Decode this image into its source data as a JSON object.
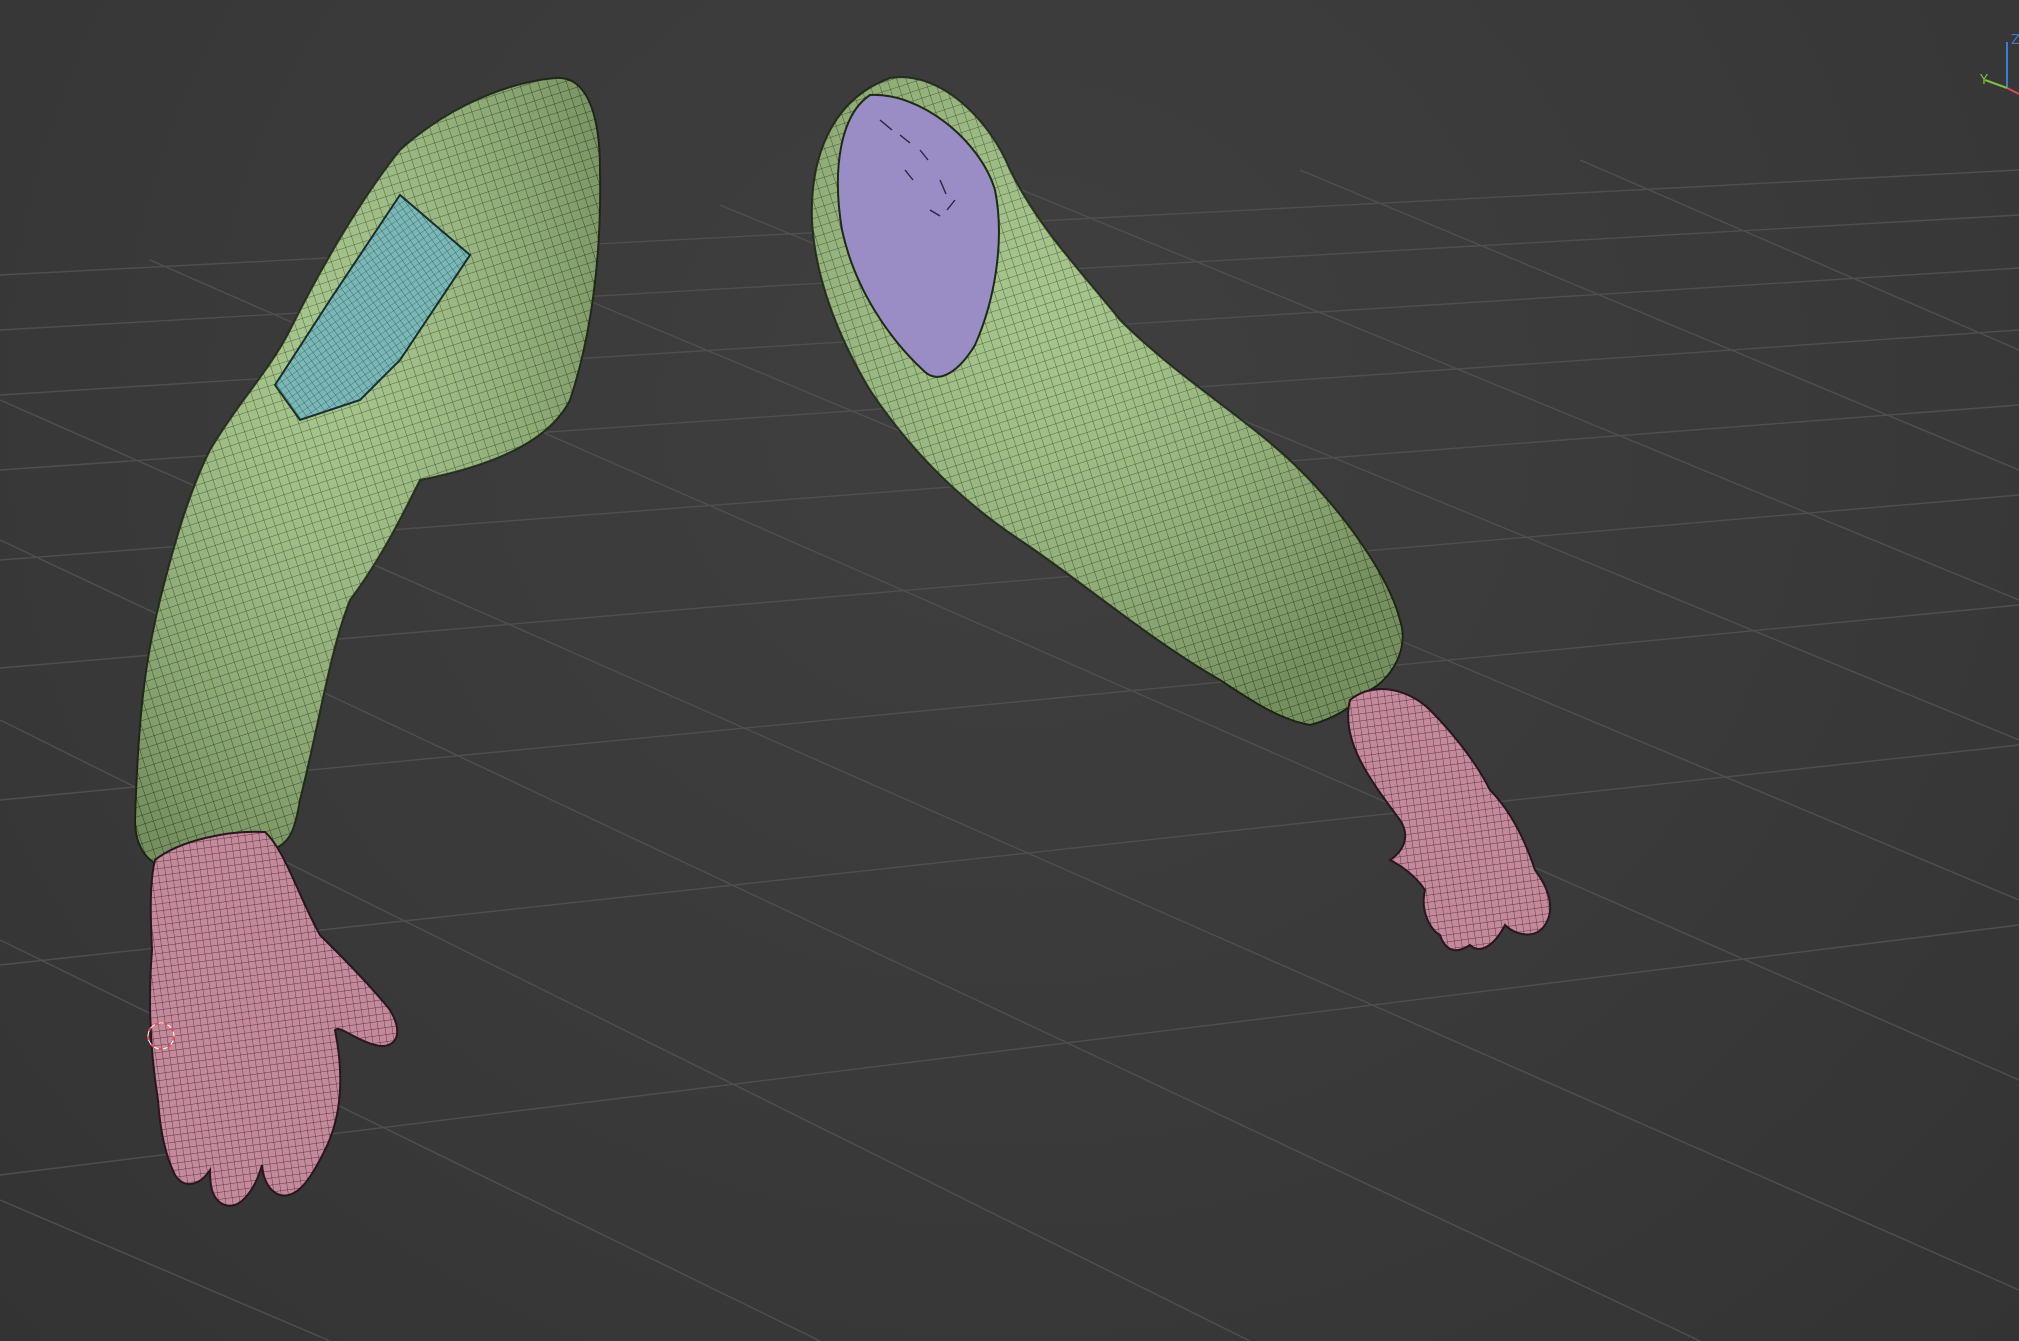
{
  "viewport": {
    "mode": "3d-view",
    "background_color": "#3a3a3a",
    "grid_color": "#4e4e4e"
  },
  "gizmo": {
    "axes": [
      {
        "label": "Z",
        "color": "#3e7bd6"
      },
      {
        "label": "Y",
        "color": "#7fbf3a"
      },
      {
        "label": "X",
        "color": "#d94b4b"
      }
    ]
  },
  "objects": [
    {
      "name": "left-sleeve",
      "material": "cloth",
      "color": "#9cc07e"
    },
    {
      "name": "left-shoulder-patch",
      "material": "patch",
      "color": "#7ab8b8"
    },
    {
      "name": "left-glove",
      "material": "glove",
      "color": "#c48a9c"
    },
    {
      "name": "right-sleeve",
      "material": "cloth",
      "color": "#9cc07e"
    },
    {
      "name": "right-sleeve-interior",
      "material": "inner",
      "color": "#9a8cc4"
    },
    {
      "name": "right-glove",
      "material": "glove",
      "color": "#c48a9c"
    }
  ],
  "cursor": {
    "color": "#e05050"
  }
}
